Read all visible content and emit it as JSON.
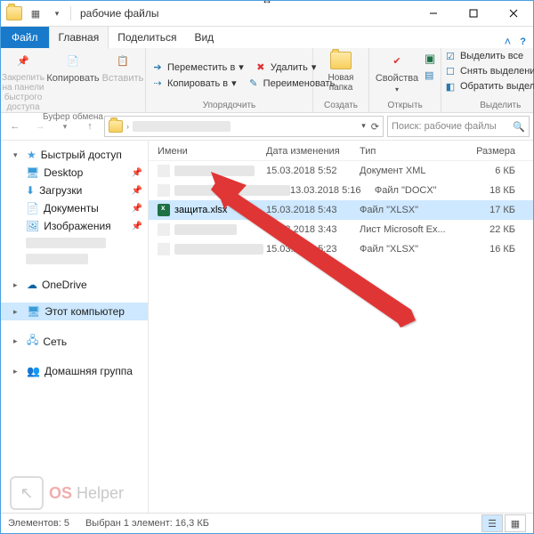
{
  "window": {
    "title": "рабочие файлы"
  },
  "tabs": {
    "file": "Файл",
    "home": "Главная",
    "share": "Поделиться",
    "view": "Вид"
  },
  "ribbon": {
    "clipboard": {
      "pin": "Закрепить на панели быстрого доступа",
      "copy": "Копировать",
      "paste": "Вставить",
      "label": "Буфер обмена"
    },
    "organize": {
      "moveTo": "Переместить в",
      "copyTo": "Копировать в",
      "delete": "Удалить",
      "rename": "Переименовать",
      "label": "Упорядочить"
    },
    "new": {
      "newFolder": "Новая папка",
      "label": "Создать"
    },
    "open": {
      "properties": "Свойства",
      "label": "Открыть"
    },
    "select": {
      "selectAll": "Выделить все",
      "deselect": "Снять выделение",
      "invert": "Обратить выделение",
      "label": "Выделить"
    }
  },
  "search": {
    "placeholder": "Поиск: рабочие файлы"
  },
  "sidebar": {
    "quick": "Быстрый доступ",
    "desktop": "Desktop",
    "downloads": "Загрузки",
    "documents": "Документы",
    "pictures": "Изображения",
    "onedrive": "OneDrive",
    "thispc": "Этот компьютер",
    "network": "Сеть",
    "homegroup": "Домашняя группа"
  },
  "columns": {
    "name": "Имени",
    "date": "Дата изменения",
    "type": "Тип",
    "size": "Размера"
  },
  "files": [
    {
      "name": "",
      "date": "15.03.2018 5:52",
      "type": "Документ XML",
      "size": "6 КБ",
      "blurred": true
    },
    {
      "name": "",
      "date": "13.03.2018 5:16",
      "type": "Файл \"DOCX\"",
      "size": "18 КБ",
      "blurred": true
    },
    {
      "name": "защита.xlsx",
      "date": "15.03.2018 5:43",
      "type": "Файл \"XLSX\"",
      "size": "17 КБ",
      "selected": true
    },
    {
      "name": "",
      "date": "15.03.2018 3:43",
      "type": "Лист Microsoft Ex...",
      "size": "22 КБ",
      "blurred": true
    },
    {
      "name": "",
      "date": "15.03.2018 5:23",
      "type": "Файл \"XLSX\"",
      "size": "16 КБ",
      "blurred": true
    }
  ],
  "status": {
    "count": "Элементов: 5",
    "selected": "Выбран 1 элемент: 16,3 КБ"
  },
  "watermark": {
    "a": "OS",
    "b": "Helper"
  },
  "colors": {
    "accent": "#1979ca",
    "selection": "#cde8ff"
  }
}
